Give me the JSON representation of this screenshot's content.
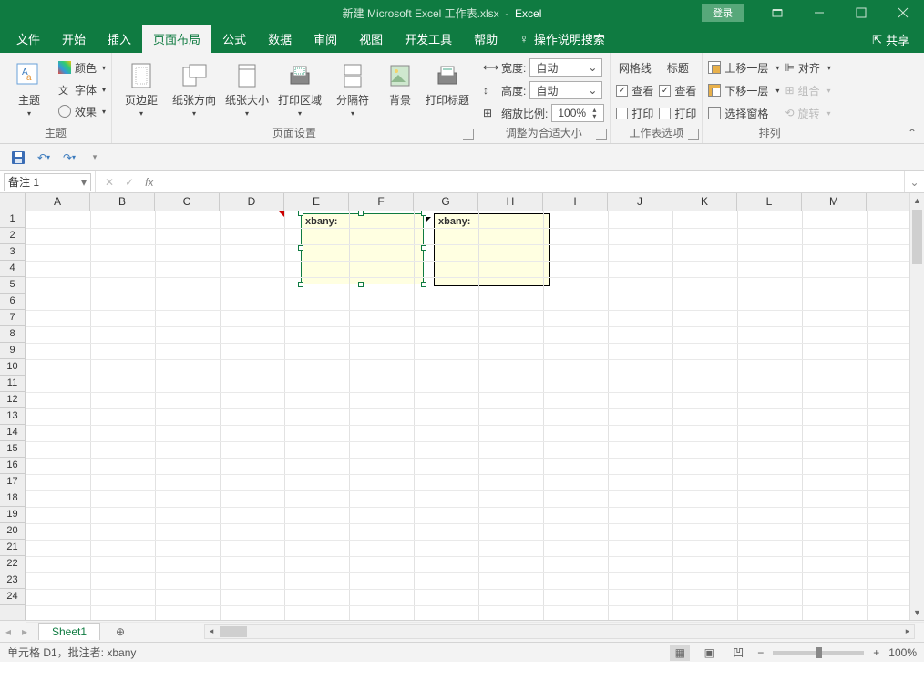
{
  "title": {
    "doc": "新建 Microsoft Excel 工作表.xlsx",
    "sep": "-",
    "app": "Excel"
  },
  "title_btns": {
    "login": "登录"
  },
  "menus": [
    "文件",
    "开始",
    "插入",
    "页面布局",
    "公式",
    "数据",
    "审阅",
    "视图",
    "开发工具",
    "帮助"
  ],
  "active_menu": 3,
  "tell_me": "操作说明搜索",
  "share": "共享",
  "ribbon": {
    "theme": {
      "label": "主题",
      "main": "主题",
      "colors": "颜色",
      "fonts": "字体",
      "effects": "效果"
    },
    "page_setup": {
      "label": "页面设置",
      "margins": "页边距",
      "orientation": "纸张方向",
      "size": "纸张大小",
      "print_area": "打印区域",
      "breaks": "分隔符",
      "background": "背景",
      "print_titles": "打印标题"
    },
    "scale": {
      "label": "调整为合适大小",
      "width_lbl": "宽度:",
      "width_val": "自动",
      "height_lbl": "高度:",
      "height_val": "自动",
      "scale_lbl": "缩放比例:",
      "scale_val": "100%"
    },
    "sheet_options": {
      "label": "工作表选项",
      "gridlines": "网格线",
      "headings": "标题",
      "view": "查看",
      "print": "打印"
    },
    "arrange": {
      "label": "排列",
      "bring_forward": "上移一层",
      "send_backward": "下移一层",
      "selection_pane": "选择窗格",
      "align": "对齐",
      "group": "组合",
      "rotate": "旋转"
    }
  },
  "name_box": "备注 1",
  "columns": [
    "A",
    "B",
    "C",
    "D",
    "E",
    "F",
    "G",
    "H",
    "I",
    "J",
    "K",
    "L",
    "M"
  ],
  "rows": [
    "1",
    "2",
    "3",
    "4",
    "5",
    "6",
    "7",
    "8",
    "9",
    "10",
    "11",
    "12",
    "13",
    "14",
    "15",
    "16",
    "17",
    "18",
    "19",
    "20",
    "21",
    "22",
    "23",
    "24"
  ],
  "comment1": "xbany:",
  "comment2": "xbany:",
  "sheet_tab": "Sheet1",
  "status_text": "单元格 D1，批注者: xbany",
  "zoom": "100%"
}
